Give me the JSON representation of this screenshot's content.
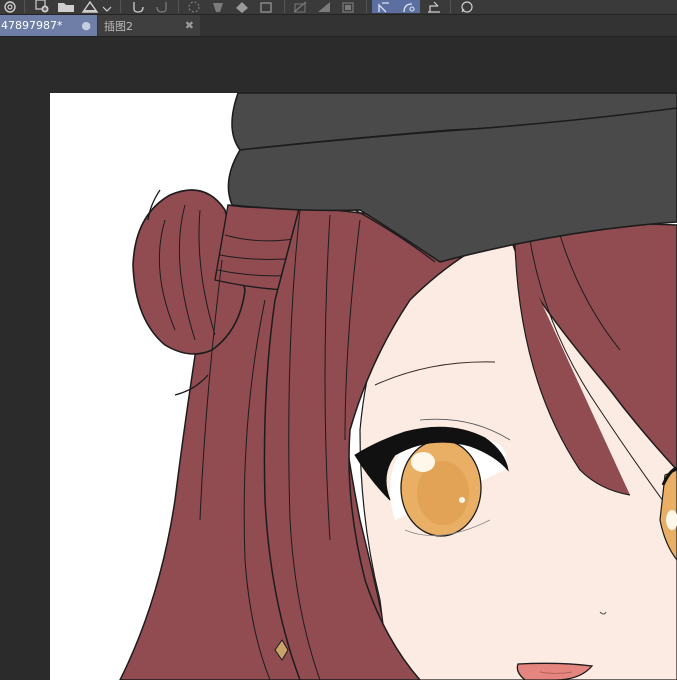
{
  "toolbar": {
    "buttons": [
      {
        "icon": "canvas-icon"
      },
      {
        "icon": "new-file-icon"
      },
      {
        "icon": "open-folder-icon"
      },
      {
        "icon": "save-icon"
      },
      {
        "icon": "dropdown-arrow-icon"
      },
      {
        "icon": "undo-icon"
      },
      {
        "icon": "redo-icon"
      },
      {
        "icon": "loading-icon"
      },
      {
        "icon": "clear-icon"
      },
      {
        "icon": "fill-icon"
      },
      {
        "icon": "transform-icon"
      },
      {
        "icon": "hide-selection-icon"
      },
      {
        "icon": "cut-icon"
      },
      {
        "icon": "copy-icon"
      },
      {
        "icon": "snap-ruler-icon"
      },
      {
        "icon": "snap-special-ruler-icon"
      },
      {
        "icon": "snap-grid-icon"
      },
      {
        "icon": "help-icon"
      }
    ]
  },
  "tabs": [
    {
      "label": "47897987*",
      "active": true
    },
    {
      "label": "插图2",
      "active": false
    }
  ],
  "colors": {
    "active_tab": "#6e7ea6",
    "hair": "#914c52",
    "hat": "#4a4a4a",
    "skin": "#fcebe2",
    "iris": "#e9b065",
    "canvas_paper": "#ffffff",
    "workspace": "#2b2b2b"
  }
}
